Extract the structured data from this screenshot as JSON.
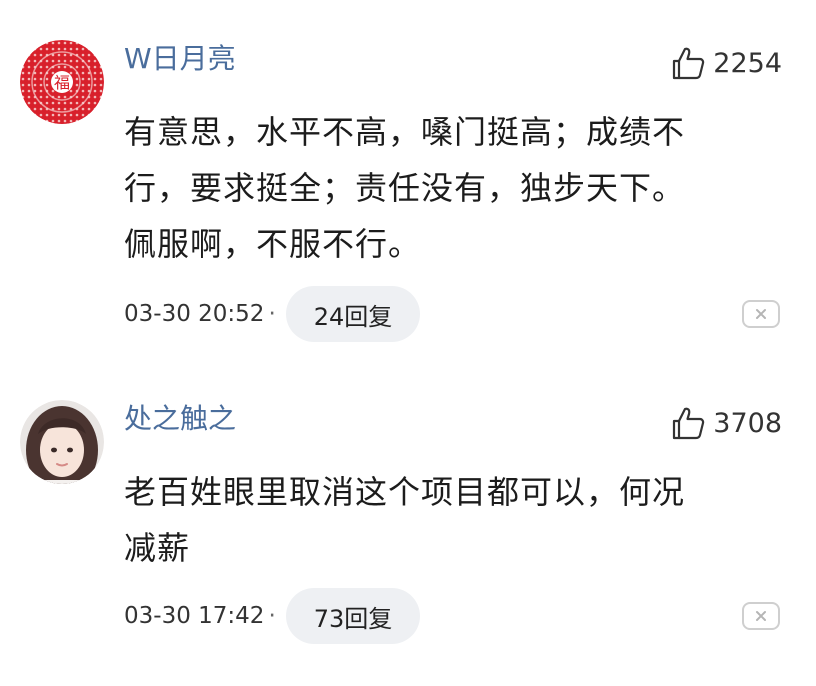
{
  "comments": [
    {
      "username": "W日月亮",
      "likes": "2254",
      "lines": [
        "有意思，水平不高，嗓门挺高；成绩不",
        "行，要求挺全；责任没有，独步天下。",
        "佩服啊，不服不行。"
      ],
      "time": "03-30 20:52",
      "separator": "·",
      "replies": "24回复",
      "avatar_icon": "red-seal-avatar",
      "avatar_glyph": "福"
    },
    {
      "username": "处之触之",
      "likes": "3708",
      "lines": [
        "老百姓眼里取消这个项目都可以，何况",
        "减薪"
      ],
      "time": "03-30 17:42",
      "separator": "·",
      "replies": "73回复",
      "avatar_icon": "portrait-avatar"
    }
  ],
  "colors": {
    "username": "#4a6d9c",
    "reply_bg": "#eef0f3",
    "avatar_red": "#d8202b"
  },
  "icons": {
    "like": "thumbs-up-icon",
    "close": "close-icon"
  }
}
